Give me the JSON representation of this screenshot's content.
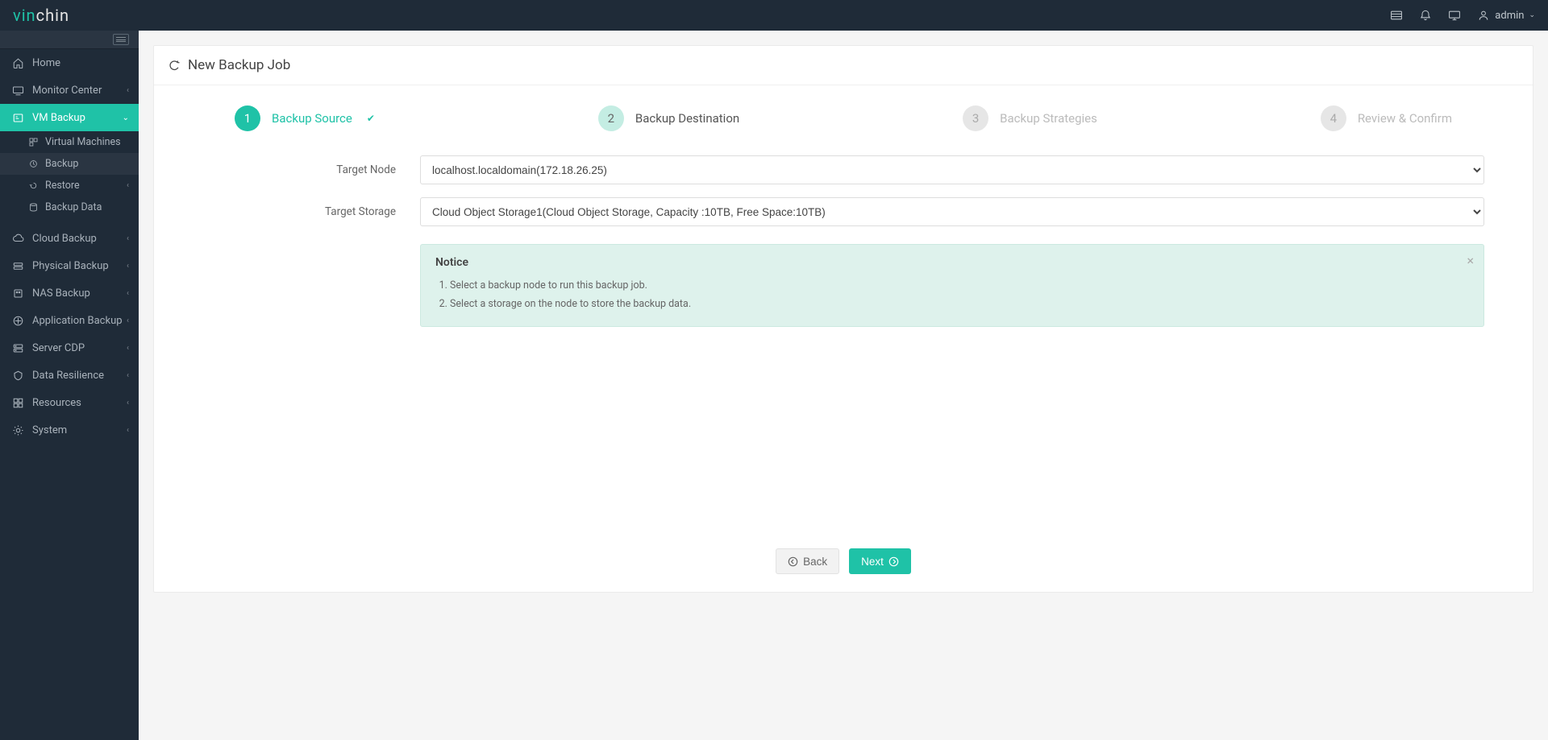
{
  "logo": {
    "part1": "vin",
    "part2": "chin"
  },
  "topbar": {
    "user_label": "admin"
  },
  "sidebar": {
    "home": "Home",
    "items": [
      {
        "label": "Monitor Center"
      },
      {
        "label": "VM Backup"
      },
      {
        "label": "Cloud Backup"
      },
      {
        "label": "Physical Backup"
      },
      {
        "label": "NAS Backup"
      },
      {
        "label": "Application Backup"
      },
      {
        "label": "Server CDP"
      },
      {
        "label": "Data Resilience"
      },
      {
        "label": "Resources"
      },
      {
        "label": "System"
      }
    ],
    "vm_backup_sub": [
      {
        "label": "Virtual Machines"
      },
      {
        "label": "Backup"
      },
      {
        "label": "Restore"
      },
      {
        "label": "Backup Data"
      }
    ]
  },
  "page": {
    "title": "New Backup Job",
    "steps": [
      {
        "num": "1",
        "label": "Backup Source"
      },
      {
        "num": "2",
        "label": "Backup Destination"
      },
      {
        "num": "3",
        "label": "Backup Strategies"
      },
      {
        "num": "4",
        "label": "Review & Confirm"
      }
    ],
    "form": {
      "target_node_label": "Target Node",
      "target_node_value": "localhost.localdomain(172.18.26.25)",
      "target_storage_label": "Target Storage",
      "target_storage_value": "Cloud Object Storage1(Cloud Object Storage, Capacity :10TB, Free Space:10TB)"
    },
    "notice": {
      "title": "Notice",
      "line1": "Select a backup node to run this backup job.",
      "line2": "Select a storage on the node to store the backup data."
    },
    "buttons": {
      "back": "Back",
      "next": "Next"
    }
  }
}
